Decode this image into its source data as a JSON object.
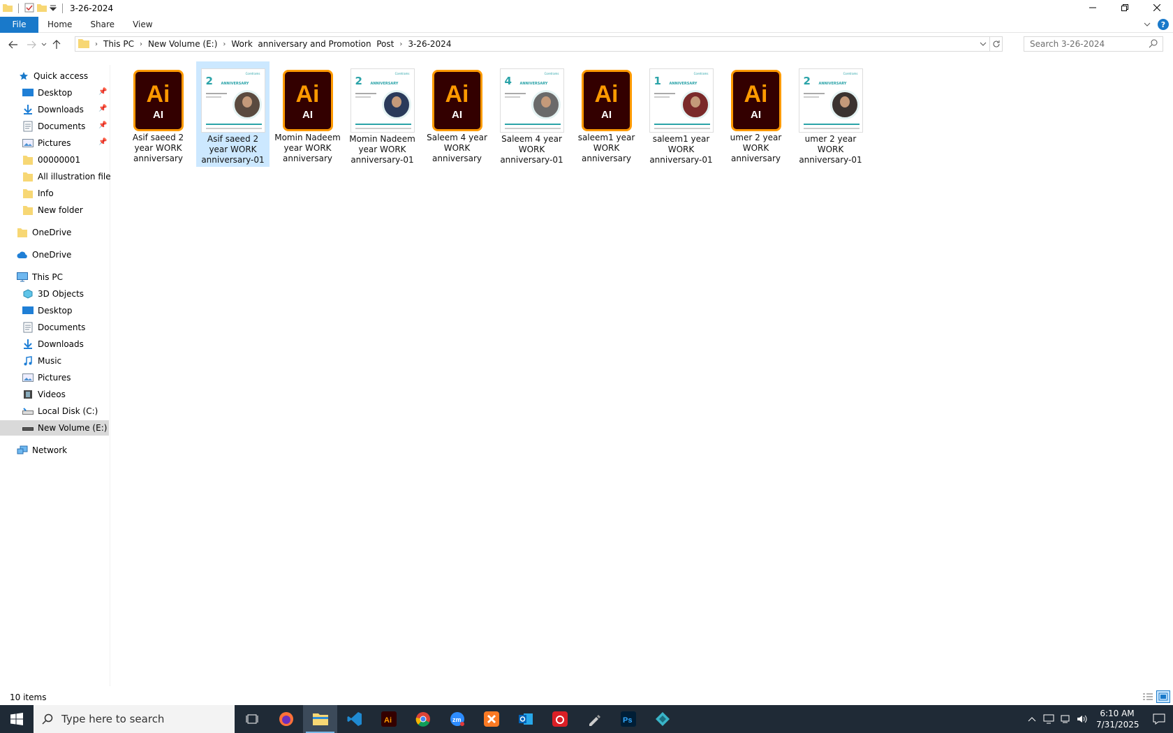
{
  "window": {
    "title": "3-26-2024"
  },
  "ribbon": {
    "file": "File",
    "tabs": [
      "Home",
      "Share",
      "View"
    ]
  },
  "address": {
    "crumbs": [
      "This PC",
      "New Volume (E:)",
      "Work  anniversary and Promotion  Post",
      "3-26-2024"
    ]
  },
  "search": {
    "placeholder": "Search 3-26-2024"
  },
  "sidebar": {
    "quick_access": "Quick access",
    "qa_items": [
      "Desktop",
      "Downloads",
      "Documents",
      "Pictures",
      "00000001",
      "All illustration file o",
      "Info",
      "New folder"
    ],
    "onedrive1": "OneDrive",
    "onedrive2": "OneDrive",
    "this_pc": "This PC",
    "pc_items": [
      "3D Objects",
      "Desktop",
      "Documents",
      "Downloads",
      "Music",
      "Pictures",
      "Videos",
      "Local Disk (C:)",
      "New Volume (E:)"
    ],
    "network": "Network"
  },
  "files": [
    {
      "type": "ai",
      "label": "Asif saeed 2  year WORK anniversary"
    },
    {
      "type": "img",
      "label": "Asif saeed 2  year WORK anniversary-01",
      "num": "2",
      "sup": "nd"
    },
    {
      "type": "ai",
      "label": "Momin Nadeem year WORK anniversary"
    },
    {
      "type": "img",
      "label": "Momin Nadeem year WORK anniversary-01",
      "num": "2",
      "sup": "nd"
    },
    {
      "type": "ai",
      "label": "Saleem 4 year WORK anniversary"
    },
    {
      "type": "img",
      "label": "Saleem 4 year WORK anniversary-01",
      "num": "4",
      "sup": "th"
    },
    {
      "type": "ai",
      "label": "saleem1 year WORK anniversary"
    },
    {
      "type": "img",
      "label": "saleem1 year WORK anniversary-01",
      "num": "1",
      "sup": "st"
    },
    {
      "type": "ai",
      "label": "umer 2  year WORK anniversary"
    },
    {
      "type": "img",
      "label": "umer 2  year WORK anniversary-01",
      "num": "2",
      "sup": "nd"
    }
  ],
  "ai_icon": {
    "big": "Ai",
    "small": "AI"
  },
  "thumb": {
    "banner": "ANNIVERSARY",
    "logo": "Coretrams"
  },
  "status": {
    "count": "10 items"
  },
  "taskbar": {
    "search_placeholder": "Type here to search",
    "time": "6:10 AM",
    "date": "7/31/2025"
  },
  "colors": {
    "accent": "#1979ca",
    "selection": "#cce8ff",
    "taskbar": "#1f2a36",
    "ai_orange": "#ff9a00",
    "ai_bg": "#330000"
  }
}
